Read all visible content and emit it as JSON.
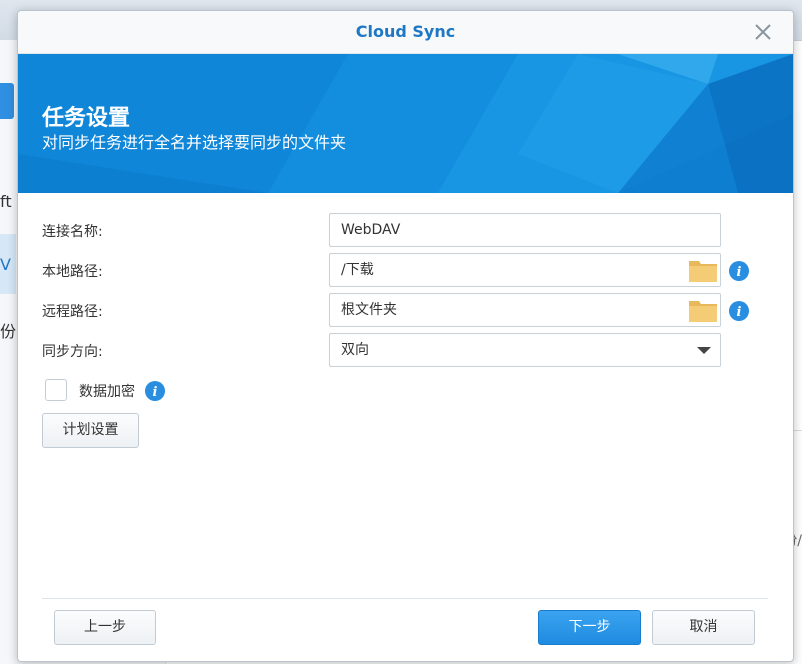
{
  "background": {
    "side_text_1": "ft",
    "side_text_2": "V",
    "side_text_3": "份",
    "right_fragment": "份/"
  },
  "dialog": {
    "title": "Cloud Sync",
    "close_icon": "close-icon"
  },
  "banner": {
    "title": "任务设置",
    "subtitle": "对同步任务进行全名并选择要同步的文件夹"
  },
  "form": {
    "connection_name_label": "连接名称:",
    "connection_name_value": "WebDAV",
    "local_path_label": "本地路径:",
    "local_path_value": "/下载",
    "remote_path_label": "远程路径:",
    "remote_path_value": "根文件夹",
    "sync_direction_label": "同步方向:",
    "sync_direction_value": "双向",
    "encrypt_label": "数据加密",
    "encrypt_checked": false,
    "schedule_button": "计划设置"
  },
  "footer": {
    "back_button": "上一步",
    "next_button": "下一步",
    "cancel_button": "取消"
  },
  "colors": {
    "accent": "#1f78c4",
    "banner": "#0f86d8",
    "primary_button": "#2790e3",
    "folder": "#f2c66d",
    "info": "#2a8ee0"
  }
}
